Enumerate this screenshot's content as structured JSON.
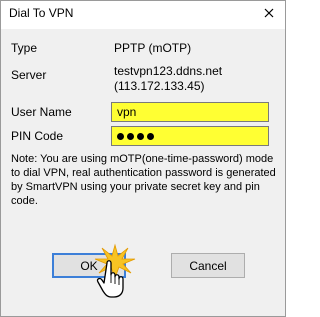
{
  "window": {
    "title": "Dial To VPN",
    "close_icon": "close-icon"
  },
  "fields": {
    "type_label": "Type",
    "type_value": "PPTP (mOTP)",
    "server_label": "Server",
    "server_host": "testvpn123.ddns.net",
    "server_ip": "(113.172.133.45)",
    "username_label": "User Name",
    "username_value": "vpn",
    "pin_label": "PIN Code",
    "pin_masked_length": 4
  },
  "note": "Note: You are using mOTP(one-time-password) mode to dial VPN, real authentication password is generated by SmartVPN using your private secret key and pin code.",
  "buttons": {
    "ok": "OK",
    "cancel": "Cancel"
  },
  "colors": {
    "field_bg": "#ffff33",
    "default_button_border": "#3c7fd8",
    "click_burst": "#f7c323"
  },
  "cursor": {
    "icon": "hand-pointer-icon",
    "effect": "click-burst"
  }
}
